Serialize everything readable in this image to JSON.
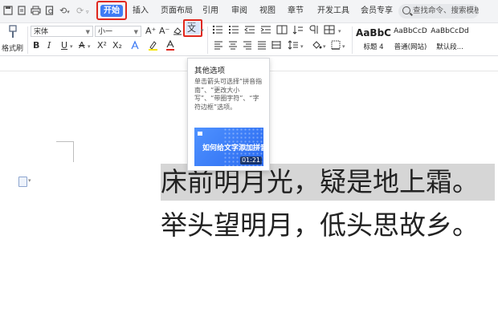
{
  "menubar": {
    "quick_access": [
      "⟲",
      "⟳"
    ],
    "tabs": {
      "home": "开始",
      "insert": "插入",
      "layout": "页面布局",
      "references": "引用",
      "review": "审阅",
      "view": "视图",
      "section": "章节",
      "developer": "开发工具",
      "member": "会员专享"
    },
    "search_placeholder": "查找命令、搜索模板"
  },
  "ribbon": {
    "format_painter_label": "格式刷",
    "font_name": "宋体",
    "font_size": "小一",
    "font_grow": "A⁺",
    "font_shrink": "A⁻",
    "bold": "B",
    "italic": "I",
    "underline": "U",
    "strike": "A",
    "superscript": "X²",
    "subscript": "X₂",
    "pinyin_glyph": "文",
    "styles": [
      {
        "sample": "AaBbC",
        "name": "标题 4"
      },
      {
        "sample": "AaBbCcD",
        "name": "普通(网站)"
      },
      {
        "sample": "AaBbCcDd",
        "name": "默认段..."
      }
    ]
  },
  "tooltip": {
    "title": "其他选项",
    "body": "单击箭头可选择“拼音指南”、“更改大小写”、“带圈字符”、“字符边框”选项。",
    "video_title": "如何给文字添加拼音",
    "video_duration": "01:21"
  },
  "document": {
    "lines": [
      "床前明月光，疑是地上霜。",
      "举头望明月，低头思故乡。"
    ]
  },
  "colors": {
    "accent": "#3e7bf4",
    "highlight_frame": "#e0271d",
    "selection": "#d6d6d6"
  }
}
